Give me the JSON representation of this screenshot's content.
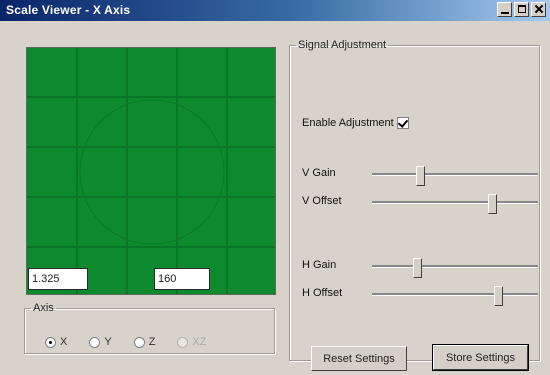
{
  "window": {
    "title": "Scale Viewer - X Axis",
    "buttons": {
      "minimize": "minimize",
      "maximize": "maximize",
      "close": "close"
    }
  },
  "scope": {
    "background_color": "#0d8a2e",
    "readout_left": "1.325",
    "readout_right": "160"
  },
  "axis": {
    "legend": "Axis",
    "options": [
      {
        "label": "X",
        "checked": true,
        "enabled": true
      },
      {
        "label": "Y",
        "checked": false,
        "enabled": true
      },
      {
        "label": "Z",
        "checked": false,
        "enabled": true
      },
      {
        "label": "XZ",
        "checked": false,
        "enabled": false
      }
    ]
  },
  "signal": {
    "legend": "Signal Adjustment",
    "enable_label": "Enable Adjustment",
    "enable_checked": true,
    "sliders": [
      {
        "label": "V Gain",
        "value": 0.29
      },
      {
        "label": "V Offset",
        "value": 0.72
      },
      {
        "label": "H Gain",
        "value": 0.27
      },
      {
        "label": "H Offset",
        "value": 0.76
      }
    ],
    "reset_label": "Reset Settings",
    "store_label": "Store Settings"
  }
}
